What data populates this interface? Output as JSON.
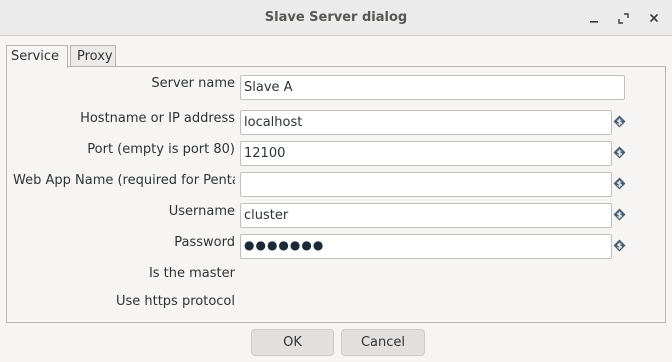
{
  "window": {
    "title": "Slave Server dialog"
  },
  "tabs": [
    {
      "label": "Service"
    },
    {
      "label": "Proxy"
    }
  ],
  "form": {
    "server_name": {
      "label": "Server name",
      "value": "Slave A"
    },
    "hostname": {
      "label": "Hostname or IP address",
      "value": "localhost"
    },
    "port": {
      "label": "Port (empty is port 80)",
      "value": "12100"
    },
    "webapp": {
      "label": "Web App Name (required for Penta",
      "value": ""
    },
    "username": {
      "label": "Username",
      "value": "cluster"
    },
    "password": {
      "label": "Password",
      "value": "●●●●●●●"
    },
    "is_master": {
      "label": "Is the master"
    },
    "https": {
      "label": "Use https protocol"
    }
  },
  "buttons": {
    "ok": "OK",
    "cancel": "Cancel"
  },
  "colors": {
    "variable_icon": "#4a5f72"
  }
}
